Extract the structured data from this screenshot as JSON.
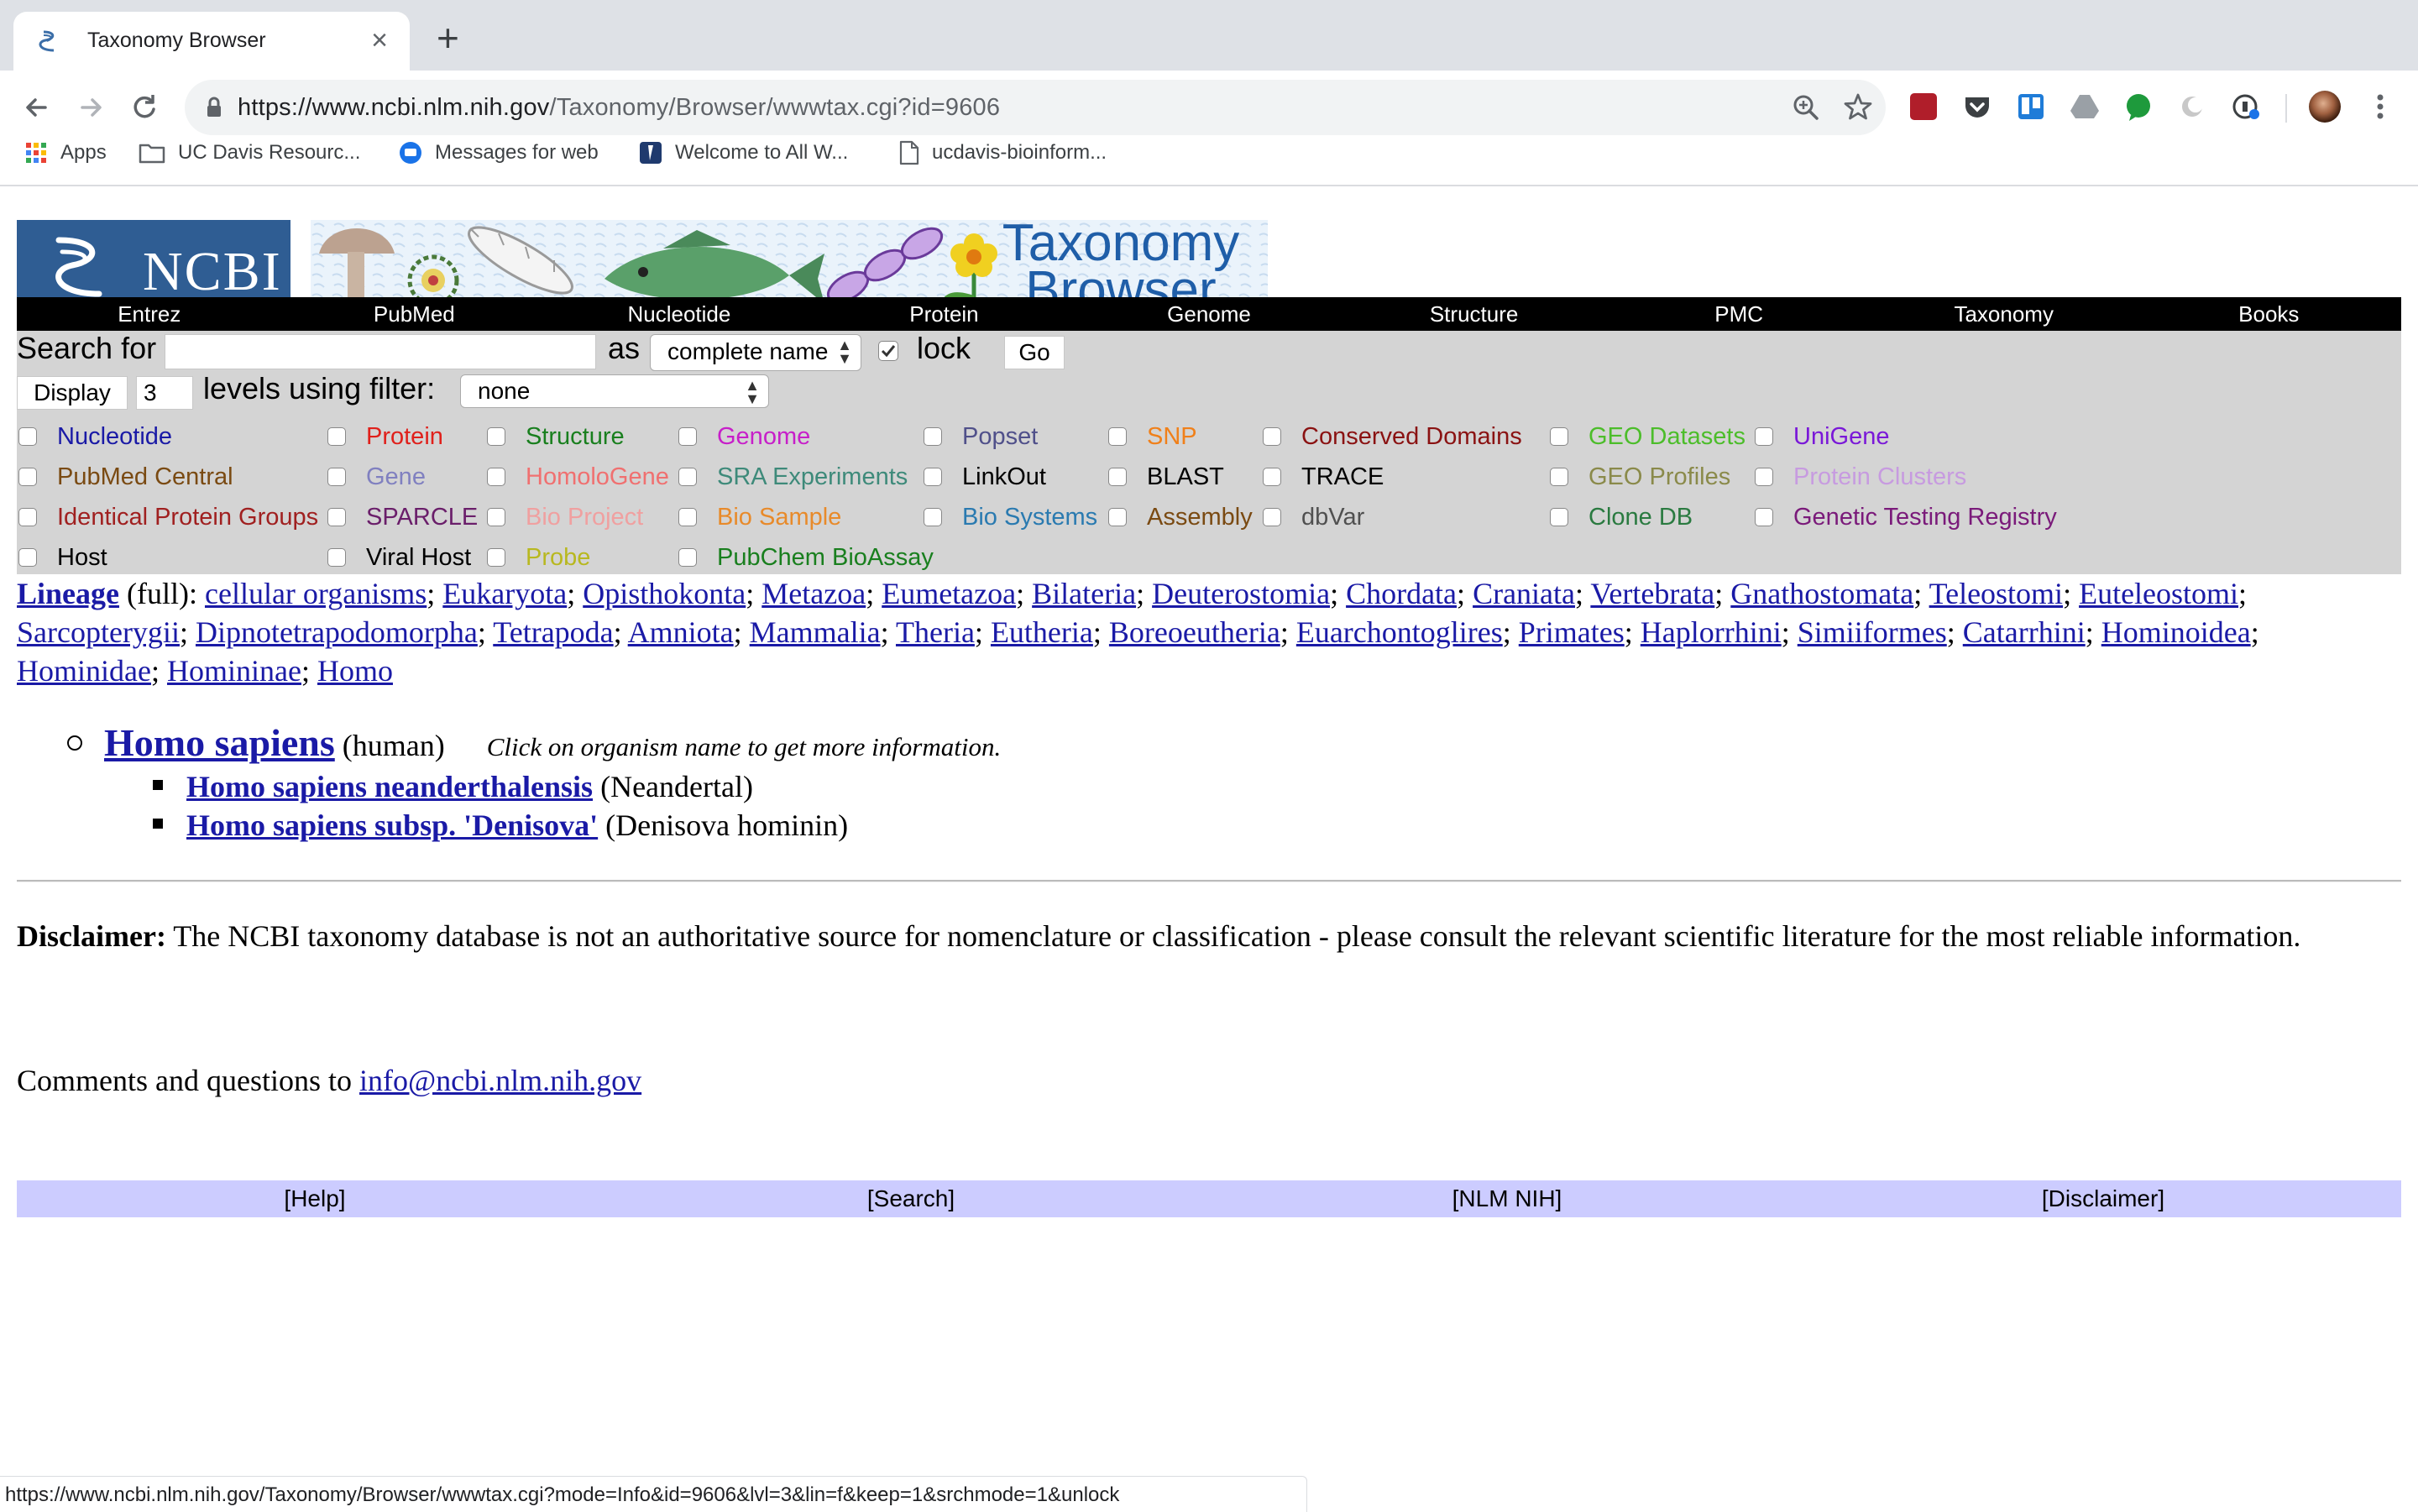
{
  "browser": {
    "tab_title": "Taxonomy Browser",
    "url_host": "https://www.ncbi.nlm.nih.gov",
    "url_path": "/Taxonomy/Browser/wwwtax.cgi?id=9606",
    "bookmarks": [
      "Apps",
      "UC Davis Resourc...",
      "Messages for web",
      "Welcome to All W...",
      "ucdavis-bioinform..."
    ],
    "status_url": "https://www.ncbi.nlm.nih.gov/Taxonomy/Browser/wwwtax.cgi?mode=Info&id=9606&lvl=3&lin=f&keep=1&srchmode=1&unlock"
  },
  "banner": {
    "logo_text": "NCBI",
    "title_line1": "Taxonomy",
    "title_line2": "Browser"
  },
  "nav": [
    "Entrez",
    "PubMed",
    "Nucleotide",
    "Protein",
    "Genome",
    "Structure",
    "PMC",
    "Taxonomy",
    "Books"
  ],
  "search": {
    "search_for_label": "Search for",
    "search_value": "",
    "as_label": "as",
    "name_type": "complete name",
    "lock_label": "lock",
    "lock_checked": true,
    "go_label": "Go",
    "display_label": "Display",
    "levels_value": "3",
    "levels_label": "levels using filter:",
    "filter_value": "none"
  },
  "databases": [
    {
      "label": "Nucleotide",
      "color": "#1a1aa6"
    },
    {
      "label": "Protein",
      "color": "#e0201b"
    },
    {
      "label": "Structure",
      "color": "#197f1e"
    },
    {
      "label": "Genome",
      "color": "#c71fc9"
    },
    {
      "label": "Popset",
      "color": "#50508a"
    },
    {
      "label": "SNP",
      "color": "#f0801a"
    },
    {
      "label": "Conserved Domains",
      "color": "#8a1212"
    },
    {
      "label": "GEO Datasets",
      "color": "#4cbd2a"
    },
    {
      "label": "UniGene",
      "color": "#7a18d8"
    },
    {
      "label": "PubMed Central",
      "color": "#7a4a12"
    },
    {
      "label": "Gene",
      "color": "#8080c0"
    },
    {
      "label": "HomoloGene",
      "color": "#f07070"
    },
    {
      "label": "SRA Experiments",
      "color": "#3e8a7a"
    },
    {
      "label": "LinkOut",
      "color": "#000000"
    },
    {
      "label": "BLAST",
      "color": "#000000"
    },
    {
      "label": "TRACE",
      "color": "#000000"
    },
    {
      "label": "GEO Profiles",
      "color": "#8a8a4a"
    },
    {
      "label": "Protein Clusters",
      "color": "#c79be0"
    },
    {
      "label": "Identical Protein Groups",
      "color": "#a02020"
    },
    {
      "label": "SPARCLE",
      "color": "#6a1e6a"
    },
    {
      "label": "Bio Project",
      "color": "#f0a0a0"
    },
    {
      "label": "Bio Sample",
      "color": "#e88a2a"
    },
    {
      "label": "Bio Systems",
      "color": "#2a7ab0"
    },
    {
      "label": "Assembly",
      "color": "#7a4a12"
    },
    {
      "label": "dbVar",
      "color": "#505050"
    },
    {
      "label": "Clone DB",
      "color": "#2a7a40"
    },
    {
      "label": "Genetic Testing Registry",
      "color": "#7a1a7a"
    },
    {
      "label": "Host",
      "color": "#000000"
    },
    {
      "label": "Viral Host",
      "color": "#000000"
    },
    {
      "label": "Probe",
      "color": "#b8b820"
    },
    {
      "label": "PubChem BioAssay",
      "color": "#197f1e"
    }
  ],
  "lineage": {
    "label": "Lineage",
    "qualifier": "(full):",
    "taxa": [
      "cellular organisms",
      "Eukaryota",
      "Opisthokonta",
      "Metazoa",
      "Eumetazoa",
      "Bilateria",
      "Deuterostomia",
      "Chordata",
      "Craniata",
      "Vertebrata",
      "Gnathostomata",
      "Teleostomi",
      "Euteleostomi",
      "Sarcopterygii",
      "Dipnotetrapodomorpha",
      "Tetrapoda",
      "Amniota",
      "Mammalia",
      "Theria",
      "Eutheria",
      "Boreoeutheria",
      "Euarchontoglires",
      "Primates",
      "Haplorrhini",
      "Simiiformes",
      "Catarrhini",
      "Hominoidea",
      "Hominidae",
      "Homininae",
      "Homo"
    ]
  },
  "organism": {
    "name": "Homo sapiens",
    "common": "(human)",
    "hint": "Click on organism name to get more information.",
    "children": [
      {
        "name": "Homo sapiens neanderthalensis",
        "common": "(Neandertal)"
      },
      {
        "name": "Homo sapiens subsp. 'Denisova'",
        "common": "(Denisova hominin)"
      }
    ]
  },
  "disclaimer": {
    "label": "Disclaimer:",
    "text": "The NCBI taxonomy database is not an authoritative source for nomenclature or classification - please consult the relevant scientific literature for the most reliable information."
  },
  "comments": {
    "text": "Comments and questions to",
    "email": "info@ncbi.nlm.nih.gov"
  },
  "footer": [
    "[Help]",
    "[Search]",
    "[NLM NIH]",
    "[Disclaimer]"
  ]
}
